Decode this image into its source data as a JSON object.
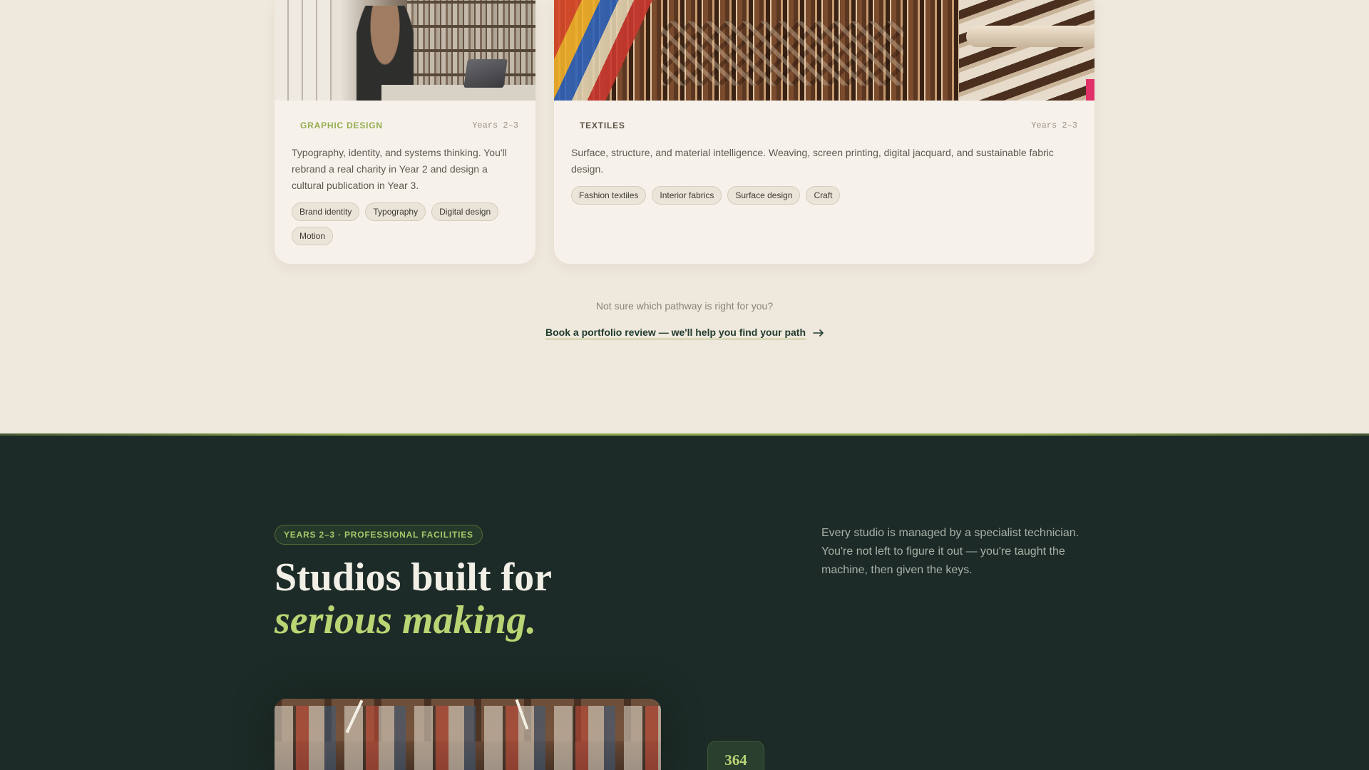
{
  "pathways": [
    {
      "tag": "GRAPHIC DESIGN",
      "years": "Years 2–3",
      "description": "Typography, identity, and systems thinking. You'll rebrand a real charity in Year 2 and design a cultural publication in Year 3.",
      "pills": [
        "Brand identity",
        "Typography",
        "Digital design",
        "Motion"
      ],
      "image": "graphic-design-studio-photo"
    },
    {
      "tag": "TEXTILES",
      "years": "Years 2–3",
      "description": "Surface, structure, and material intelligence. Weaving, screen printing, digital jacquard, and sustainable fabric design.",
      "pills": [
        "Fashion textiles",
        "Interior fabrics",
        "Surface design",
        "Craft"
      ],
      "image": "textiles-loom-photo"
    }
  ],
  "helper": {
    "question": "Not sure which pathway is right for you?",
    "cta_label": "Book a portfolio review — we'll help you find your path",
    "cta_icon": "arrow-right-icon"
  },
  "facilities": {
    "eyebrow": "YEARS 2–3 · PROFESSIONAL FACILITIES",
    "heading_line1": "Studios built for",
    "heading_line2": "serious making.",
    "intro": "Every studio is managed by a specialist technician. You're not left to figure it out — you're taught the machine, then given the keys.",
    "stat_value": "364",
    "image": "printmaking-studio-photo"
  },
  "colors": {
    "accent_green": "#8ba54a",
    "heading_accent": "#b9d574",
    "dark_bg": "#1c2b27",
    "light_bg": "#efe8dc"
  }
}
